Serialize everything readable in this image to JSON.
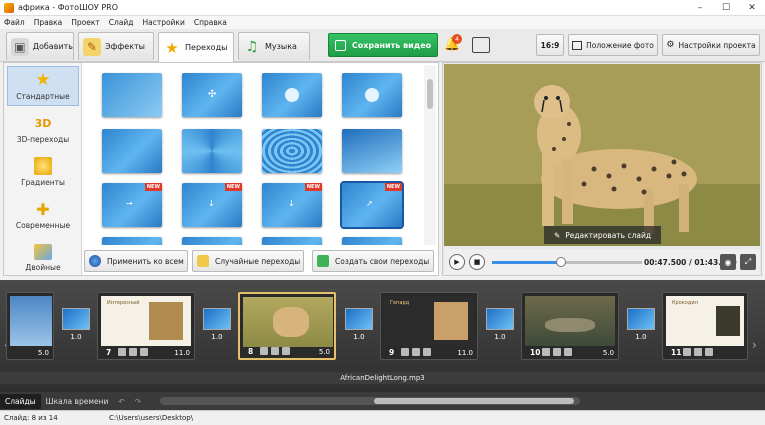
{
  "window": {
    "title": "африка - ФотоШОУ PRO",
    "min": "–",
    "max": "☐",
    "close": "✕"
  },
  "menu": [
    "Файл",
    "Правка",
    "Проект",
    "Слайд",
    "Настройки",
    "Справка"
  ],
  "tabs": [
    {
      "label": "Добавить",
      "icon": "add-photos-icon"
    },
    {
      "label": "Эффекты",
      "icon": "effects-palette-icon"
    },
    {
      "label": "Переходы",
      "icon": "star-icon"
    },
    {
      "label": "Музыка",
      "icon": "music-note-icon"
    }
  ],
  "toolbar": {
    "save_label": "Сохранить видео",
    "notify_count": "4",
    "ratio_label": "16:9",
    "photo_position_label": "Положение фото",
    "project_settings_label": "Настройки проекта"
  },
  "categories": [
    {
      "label": "Стандартные",
      "icon": "star-icon",
      "badge": ""
    },
    {
      "label": "3D-переходы",
      "icon": "3d-icon",
      "badge": "3D"
    },
    {
      "label": "Градиенты",
      "icon": "gradient-icon",
      "badge": ""
    },
    {
      "label": "Современные",
      "icon": "puzzle-icon",
      "badge": ""
    },
    {
      "label": "Двойные",
      "icon": "double-icon",
      "badge": ""
    }
  ],
  "transitions": {
    "new_badge": "NEW",
    "apply_all": "Применить ко всем",
    "random": "Случайные переходы",
    "create_own": "Создать свои переходы"
  },
  "preview": {
    "edit_slide": "Редактировать слайд",
    "time": "00:47.500 / 01:43.500",
    "progress": 0.46
  },
  "timeline": {
    "slides": [
      {
        "num": "",
        "duration": "5.0"
      },
      {
        "num": "7",
        "duration": "11.0",
        "caption": "Интересный"
      },
      {
        "num": "8",
        "duration": "5.0"
      },
      {
        "num": "9",
        "duration": "11.0",
        "caption": "Гепард"
      },
      {
        "num": "10",
        "duration": "5.0"
      },
      {
        "num": "11",
        "duration": "",
        "caption": "Крокодил"
      }
    ],
    "transition_durations": [
      "1.0",
      "1.0",
      "1.0",
      "1.0",
      "1.0"
    ],
    "audio": "AfricanDelightLong.mp3"
  },
  "bottom_tabs": [
    "Слайды",
    "Шкала времени"
  ],
  "status": {
    "slide_info": "Слайд: 8 из 14",
    "path": "C:\\Users\\users\\Desktop\\"
  },
  "colors": {
    "accent": "#1f9e47",
    "selection": "#cfe0f3",
    "current_slide": "#e7c06a"
  }
}
